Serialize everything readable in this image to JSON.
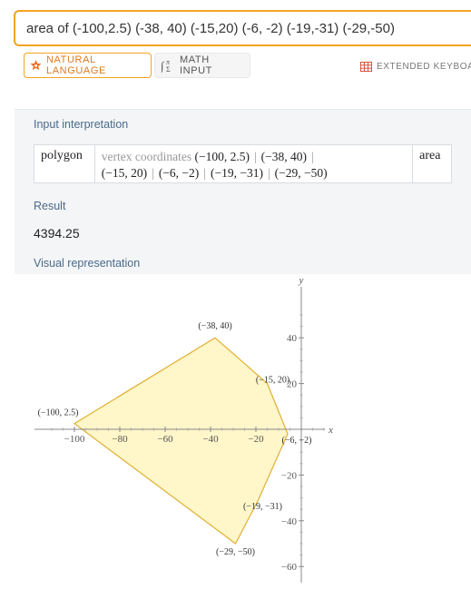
{
  "search": {
    "value": "area of (-100,2.5) (-38, 40) (-15,20) (-6, -2) (-19,-31) (-29,-50)"
  },
  "modes": {
    "natural_language": "NATURAL LANGUAGE",
    "math_input": "MATH INPUT",
    "extended_keyboard": "EXTENDED KEYBOA"
  },
  "pods": {
    "input_interpretation": {
      "title": "Input interpretation",
      "head": "polygon",
      "label": "vertex coordinates",
      "vertices": [
        "(−100, 2.5)",
        "(−38, 40)",
        "(−15, 20)",
        "(−6, −2)",
        "(−19, −31)",
        "(−29, −50)"
      ],
      "tail": "area"
    },
    "result": {
      "title": "Result",
      "value": "4394.25"
    },
    "visual": {
      "title": "Visual representation"
    }
  },
  "colors": {
    "accent": "#f4a324",
    "pod_title": "#4b6a8a",
    "polygon_fill": "#fff6c9",
    "polygon_stroke": "#e0b030"
  },
  "chart_data": {
    "type": "scatter",
    "shape": "polygon",
    "points": [
      {
        "x": -100,
        "y": 2.5,
        "label": "(−100, 2.5)"
      },
      {
        "x": -38,
        "y": 40,
        "label": "(−38, 40)"
      },
      {
        "x": -15,
        "y": 20,
        "label": "(−15, 20)"
      },
      {
        "x": -6,
        "y": -2,
        "label": "(−6, −2)"
      },
      {
        "x": -19,
        "y": -31,
        "label": "(−19, −31)"
      },
      {
        "x": -29,
        "y": -50,
        "label": "(−29, −50)"
      }
    ],
    "x_ticks": [
      -100,
      -80,
      -60,
      -40,
      -20
    ],
    "x_tick_labels": [
      "−100",
      "−80",
      "−60",
      "−40",
      "−20"
    ],
    "y_ticks": [
      40,
      20,
      -20,
      -40,
      -60
    ],
    "y_tick_labels": [
      "40",
      "20",
      "−20",
      "−40",
      "−60"
    ],
    "xlabel": "x",
    "ylabel": "y",
    "xlim": [
      -115,
      15
    ],
    "ylim": [
      -63,
      55
    ],
    "grid": false
  }
}
